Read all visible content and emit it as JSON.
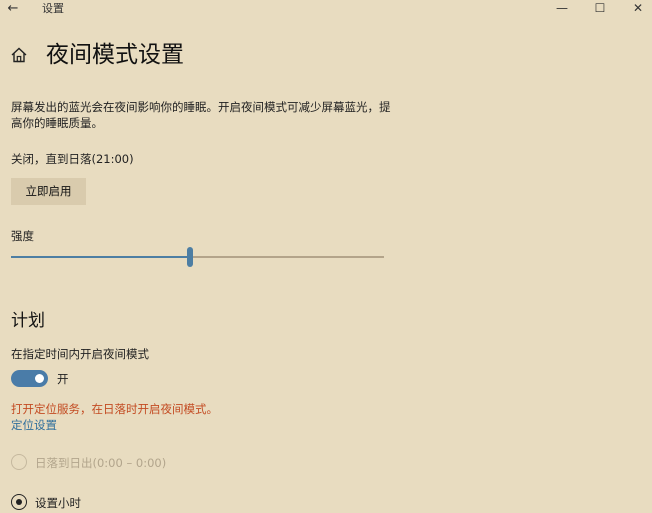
{
  "window": {
    "title": "设置",
    "back_glyph": "←",
    "minimize_glyph": "—",
    "maximize_glyph": "☐",
    "close_glyph": "✕"
  },
  "header": {
    "home_icon": "home-icon",
    "title": "夜间模式设置"
  },
  "intro": {
    "description": "屏幕发出的蓝光会在夜间影响你的睡眠。开启夜间模式可减少屏幕蓝光，提高你的睡眠质量。",
    "status": "关闭，直到日落(21:00)",
    "enable_button": "立即启用"
  },
  "strength": {
    "label": "强度",
    "value_fraction": 0.48
  },
  "schedule": {
    "section_title": "计划",
    "toggle_label": "在指定时间内开启夜间模式",
    "toggle_state": "开",
    "toggle_on": true,
    "warning": "打开定位服务，在日落时开启夜间模式。",
    "location_link": "定位设置",
    "options": [
      {
        "label": "日落到日出(0:00 – 0:00)",
        "selected": false,
        "enabled": false
      },
      {
        "label": "设置小时",
        "selected": true,
        "enabled": true
      }
    ]
  },
  "colors": {
    "background": "#e8dcc0",
    "accent": "#4d7ea3",
    "warning": "#c34b22",
    "link": "#2f6f9c"
  }
}
